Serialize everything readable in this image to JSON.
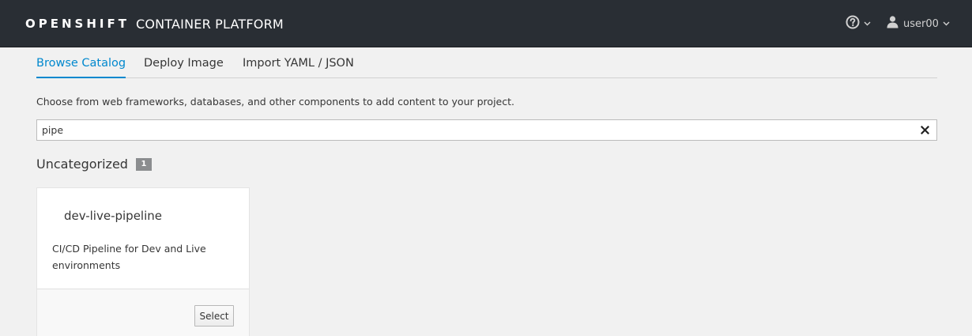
{
  "header": {
    "brand_bold": "OPENSHIFT",
    "brand_light": "CONTAINER PLATFORM",
    "help_icon": "question-circle-icon",
    "user_icon": "user-icon",
    "username": "user00"
  },
  "tabs": [
    {
      "label": "Browse Catalog",
      "active": true
    },
    {
      "label": "Deploy Image",
      "active": false
    },
    {
      "label": "Import YAML / JSON",
      "active": false
    }
  ],
  "intro_text": "Choose from web frameworks, databases, and other components to add content to your project.",
  "search": {
    "value": "pipe",
    "clear_icon": "close-icon"
  },
  "category": {
    "title": "Uncategorized",
    "count": "1"
  },
  "cards": [
    {
      "title": "dev-live-pipeline",
      "description": "CI/CD Pipeline for Dev and Live environments",
      "select_label": "Select"
    }
  ],
  "colors": {
    "topbar": "#292e34",
    "accent": "#0088ce",
    "background": "#f1f1f1",
    "badge": "#8b8d8f"
  }
}
